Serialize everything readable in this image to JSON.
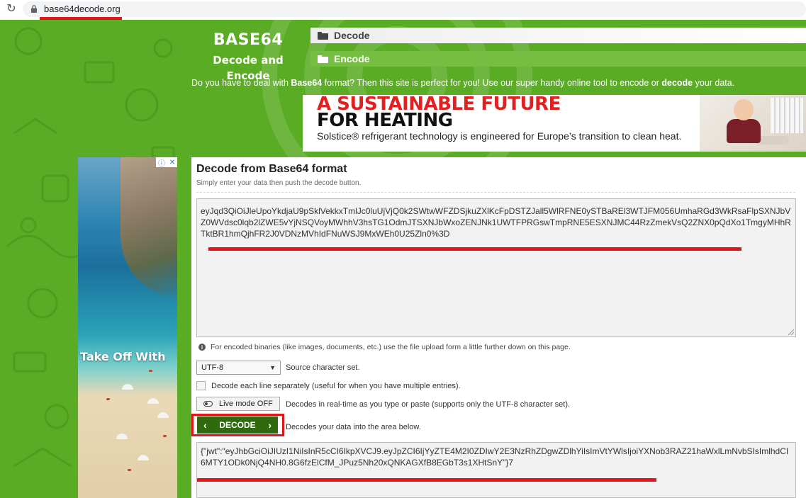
{
  "browser": {
    "url": "base64decode.org"
  },
  "site": {
    "logo_title": "BASE64",
    "logo_subtitle": "Decode and Encode",
    "nav": {
      "decode": "Decode",
      "encode": "Encode"
    },
    "tagline": {
      "part1": "Do you have to deal with ",
      "bold1": "Base64",
      "part2": " format? Then this site is perfect for you! Use our super handy online tool to encode or ",
      "bold2": "decode",
      "part3": " your data."
    }
  },
  "ad_top": {
    "headline1": "A SUSTAINABLE FUTURE",
    "headline2": "FOR HEATING",
    "subline": "Solstice® refrigerant technology is engineered for Europe’s transition to clean heat."
  },
  "ad_left": {
    "text": "Take Off With"
  },
  "panel": {
    "title": "Decode from Base64 format",
    "subtitle": "Simply enter your data then push the decode button.",
    "input_value": "eyJqd3QiOiJleUpoYkdjaU9pSklVekkxTmlJc0luUjVjQ0k2SWtwWFZDSjkuZXlKcFpDSTZJall5WlRFNE0ySTBaREl3WTJFM056UmhaRGd3WkRsaFlpSXNJbVZ0WVdsc0lqb2lZWE5vYjNSQVoyMWhhV3hsTG1OdmJTSXNJbWxoZENJNk1UWTFPRGswTmpRNE5ESXNJMC44RzZmekVsQ2ZNX0pQdXo1TmgyMHhRTktBR1hmQjhFR2J0VDNzMVhIdFNuWSJ9MxWEh0U25Zln0%3D",
    "info_text": "For encoded binaries (like images, documents, etc.) use the file upload form a little further down on this page.",
    "charset_value": "UTF-8",
    "charset_label": "Source character set.",
    "each_line_label": "Decode each line separately (useful for when you have multiple entries).",
    "live_mode_button": "Live mode OFF",
    "live_mode_label": "Decodes in real-time as you type or paste (supports only the UTF-8 character set).",
    "decode_button": "DECODE",
    "decode_label": "Decodes your data into the area below.",
    "output_value": "{\"jwt\":\"eyJhbGciOiJIUzI1NiIsInR5cCI6IkpXVCJ9.eyJpZCI6IjYyZTE4M2I0ZDIwY2E3NzRhZDgwZDlhYiIsImVtYWlsIjoiYXNob3RAZ21haWxlLmNvbSIsImlhdCI6MTY1ODk0NjQ4NH0.8G6fzElCfM_JPuz5Nh20xQNKAGXfB8EGbT3s1XHtSnY\"}7"
  },
  "colors": {
    "brand_green": "#5aac24",
    "decode_button": "#2f6b0e",
    "annotation_red": "#e3141b"
  }
}
